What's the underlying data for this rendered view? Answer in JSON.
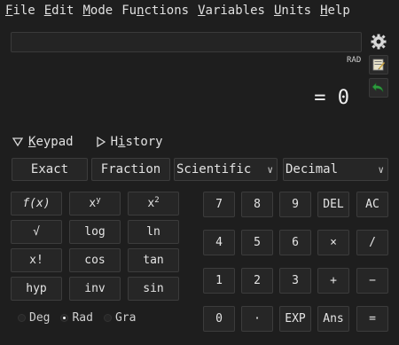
{
  "menu": [
    {
      "mnemonic": "F",
      "rest": "ile"
    },
    {
      "mnemonic": "E",
      "rest": "dit"
    },
    {
      "mnemonic": "M",
      "rest": "ode"
    },
    {
      "mnemonic": "",
      "rest": "Fu",
      "mn2": "n",
      "rest2": "ctions"
    },
    {
      "mnemonic": "V",
      "rest": "ariables"
    },
    {
      "mnemonic": "U",
      "rest": "nits"
    },
    {
      "mnemonic": "H",
      "rest": "elp"
    }
  ],
  "expression": {
    "value": "",
    "placeholder": ""
  },
  "angle_mode_indicator": "RAD",
  "result": "= 0",
  "toggles": {
    "keypad": {
      "mnemonic": "K",
      "rest": "eypad"
    },
    "history": {
      "pre": "H",
      "mnemonic": "i",
      "rest": "story"
    }
  },
  "mode_buttons": {
    "exact": "Exact",
    "fraction": "Fraction"
  },
  "selects": {
    "keypad_type": "Scientific",
    "number_base": "Decimal"
  },
  "function_keys": [
    [
      "f(x)",
      "x^y",
      "x^2"
    ],
    [
      "√",
      "log",
      "ln"
    ],
    [
      "x!",
      "cos",
      "tan"
    ],
    [
      "hyp",
      "inv",
      "sin"
    ]
  ],
  "fn_labels": {
    "fx": "f(x)",
    "xy_base": "x",
    "xy_exp": "y",
    "x2_base": "x",
    "x2_exp": "2",
    "sqrt": "√",
    "log": "log",
    "ln": "ln",
    "fact": "x!",
    "cos": "cos",
    "tan": "tan",
    "hyp": "hyp",
    "inv": "inv",
    "sin": "sin"
  },
  "numpad": {
    "r1": [
      "7",
      "8",
      "9",
      "DEL",
      "AC"
    ],
    "r2": [
      "4",
      "5",
      "6",
      "×",
      "/"
    ],
    "r3": [
      "1",
      "2",
      "3",
      "+",
      "−"
    ],
    "r4": [
      "0",
      "·",
      "EXP",
      "Ans",
      "="
    ]
  },
  "angle_units": {
    "deg": "Deg",
    "rad": "Rad",
    "gra": "Gra",
    "selected": "rad"
  },
  "icons": {
    "settings": "gear-icon",
    "store": "store-variable-icon",
    "undo": "undo-arrow-icon",
    "accent_green": "#2e9a3e"
  }
}
